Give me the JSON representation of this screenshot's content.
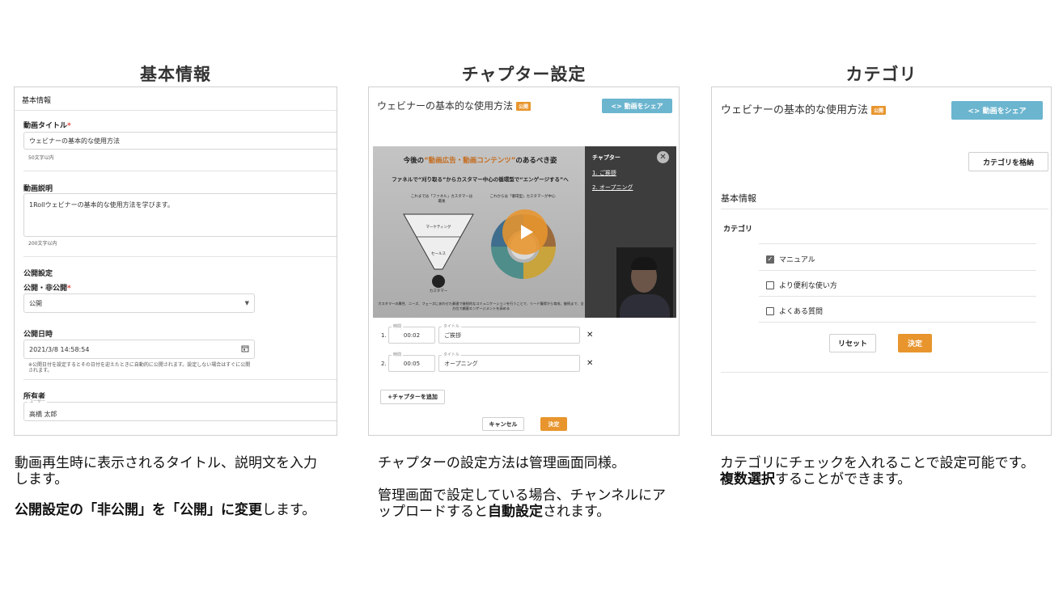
{
  "headings": [
    "基本情報",
    "チャプター設定",
    "カテゴリ"
  ],
  "panel1": {
    "header": "基本情報",
    "title_label": "動画タイトル",
    "required_mark": "*",
    "title_value": "ウェビナーの基本的な使用方法",
    "title_hint": "50文字以内",
    "desc_label": "動画説明",
    "desc_value": "1Rollウェビナーの基本的な使用方法を学びます。",
    "desc_hint": "200文字以内",
    "publish_section": "公開設定",
    "publish_label": "公開・非公開",
    "publish_value": "公開",
    "date_label": "公開日時",
    "date_value": "2021/3/8 14:58:54",
    "date_hint": "※公開日付を設定するとその日付を迎えたときに自動的に公開されます。設定しない場合はすぐに公開されます。",
    "owner_label": "所有者",
    "owner_sublabel": "ユーザー",
    "owner_value": "高橋 太郎"
  },
  "panel2": {
    "title": "ウェビナーの基本的な使用方法",
    "badge": "公開",
    "share_button": "<> 動画をシェア",
    "slide_title_pre": "今後の",
    "slide_title_em": "“動画広告・動画コンテンツ”",
    "slide_title_post": "のあるべき姿",
    "slide_subtitle": "ファネルで“刈り取る”からカスタマー中心の循環型で“エンゲージする”へ",
    "slide_left_caption": "これまでは「ファネル」カスタマーは最後",
    "slide_right_caption": "これからは「循環型」カスタマーが中心",
    "funnel_top": "マーケティング",
    "funnel_mid": "セールス",
    "funnel_bottom": "カスタマー",
    "slide_footer": "カスタマーの属性、ニーズ、フェーズにあわせた最適で継続的なコミュニケーションを行うことで、リード獲得から育成、継続まで、全方位で顧客エンゲージメントを高める",
    "chapter_panel_title": "チャプター",
    "chapter_links": [
      "1. ご挨拶",
      "2. オープニング"
    ],
    "time_label": "時間",
    "name_label": "タイトル",
    "rows": [
      {
        "num": "1.",
        "time": "00:02",
        "title": "ご挨拶"
      },
      {
        "num": "2.",
        "time": "00:05",
        "title": "オープニング"
      }
    ],
    "add_button": "+チャプターを追加",
    "cancel_button": "キャンセル",
    "ok_button": "決定"
  },
  "panel3": {
    "title": "ウェビナーの基本的な使用方法",
    "badge": "公開",
    "share_button": "<> 動画をシェア",
    "store_button": "カテゴリを格納",
    "section": "基本情報",
    "category_label": "カテゴリ",
    "options": [
      {
        "label": "マニュアル",
        "checked": true
      },
      {
        "label": "より便利な使い方",
        "checked": false
      },
      {
        "label": "よくある質問",
        "checked": false
      }
    ],
    "reset_button": "リセット",
    "ok_button": "決定"
  },
  "captions": {
    "c1_line1": "動画再生時に表示されるタイトル、説明文を入力します。",
    "c1_bold": "公開設定の「非公開」を「公開」に変更",
    "c1_rest": "します。",
    "c2_p1": "チャプターの設定方法は管理画面同様。",
    "c2_p2_pre": "管理画面で設定している場合、チャンネルにアップロードすると",
    "c2_p2_bold": "自動設定",
    "c2_p2_post": "されます。",
    "c3_pre": "カテゴリにチェックを入れることで設定可能です。",
    "c3_bold": "複数選択",
    "c3_post": "することができます。"
  },
  "colors": {
    "accent": "#e8952e",
    "share": "#6bb5cf",
    "required": "#e0483e"
  }
}
